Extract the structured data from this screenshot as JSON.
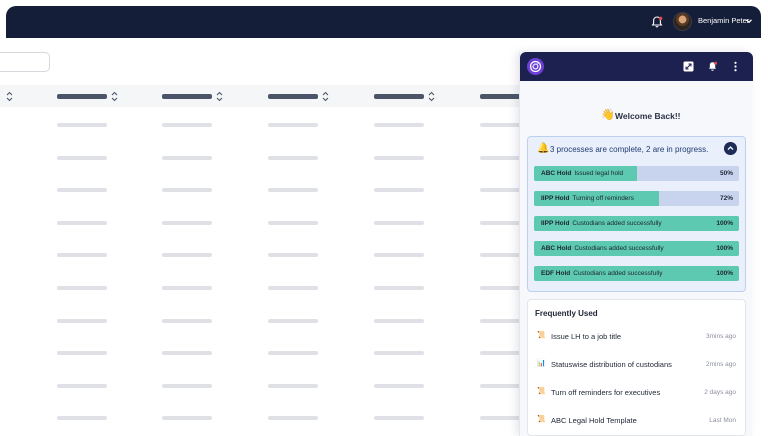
{
  "topbar": {
    "user_name": "Benjamin Peter"
  },
  "panel": {
    "welcome": "Welcome Back!!",
    "summary": "3 processes are complete, 2 are in progress.",
    "processes": [
      {
        "name": "ABC Hold",
        "status": "Issued legal hold",
        "percent_label": "50%",
        "progress": 0.5
      },
      {
        "name": "IIPP Hold",
        "status": "Turning off reminders",
        "percent_label": "72%",
        "progress": 0.61
      },
      {
        "name": "IIPP Hold",
        "status": "Custodians added successfully",
        "percent_label": "100%",
        "progress": 1.0
      },
      {
        "name": "ABC Hold",
        "status": "Custodians added successfully",
        "percent_label": "100%",
        "progress": 1.0
      },
      {
        "name": "EDF Hold",
        "status": "Custodians added successfully",
        "percent_label": "100%",
        "progress": 1.0
      }
    ],
    "frequently_used": {
      "title": "Frequently Used",
      "items": [
        {
          "icon": "📜",
          "icon_name": "scroll-icon",
          "label": "Issue LH to a job title",
          "time": "3mins ago"
        },
        {
          "icon": "📊",
          "icon_name": "bar-chart-icon",
          "label": "Statuswise distribution of custodians",
          "time": "2mins ago"
        },
        {
          "icon": "📜",
          "icon_name": "scroll-icon",
          "label": "Turn off reminders for executives",
          "time": "2 days ago"
        },
        {
          "icon": "📜",
          "icon_name": "scroll-icon",
          "label": "ABC Legal Hold Template",
          "time": "Last Mon"
        }
      ]
    }
  },
  "colors": {
    "header": "#141e38",
    "panel_header": "#1c2150",
    "progress_fill": "#5cc9b0",
    "progress_track": "#c8d4ed",
    "accent": "#6b3fd4"
  }
}
